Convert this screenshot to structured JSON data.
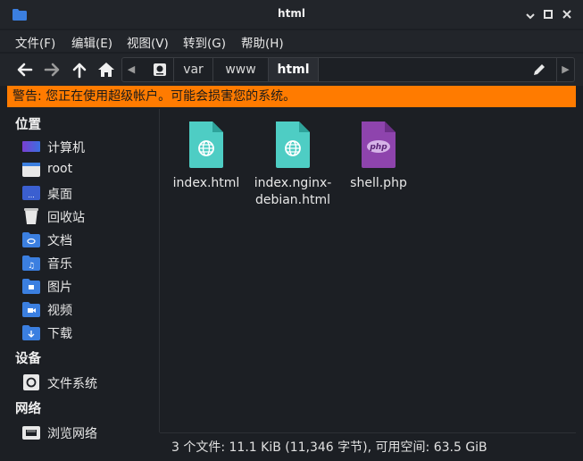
{
  "window": {
    "title": "html"
  },
  "menu": [
    "文件(F)",
    "编辑(E)",
    "视图(V)",
    "转到(G)",
    "帮助(H)"
  ],
  "path": {
    "segments": [
      "var",
      "www",
      "html"
    ],
    "active": "html"
  },
  "warning": "警告: 您正在使用超级帐户。可能会损害您的系统。",
  "sidebar": {
    "places_title": "位置",
    "places": [
      {
        "label": "计算机",
        "icon": "computer-icon"
      },
      {
        "label": "root",
        "icon": "home-folder-icon"
      },
      {
        "label": "桌面",
        "icon": "desktop-icon"
      },
      {
        "label": "回收站",
        "icon": "trash-icon"
      },
      {
        "label": "文档",
        "icon": "documents-folder-icon"
      },
      {
        "label": "音乐",
        "icon": "music-folder-icon"
      },
      {
        "label": "图片",
        "icon": "pictures-folder-icon"
      },
      {
        "label": "视频",
        "icon": "videos-folder-icon"
      },
      {
        "label": "下载",
        "icon": "downloads-folder-icon"
      }
    ],
    "devices_title": "设备",
    "devices": [
      {
        "label": "文件系统",
        "icon": "drive-icon"
      }
    ],
    "network_title": "网络",
    "network": [
      {
        "label": "浏览网络",
        "icon": "network-icon"
      }
    ]
  },
  "files": [
    {
      "name": "index.html",
      "icon": "html-file-icon"
    },
    {
      "name": "index.nginx-debian.html",
      "name_line1": "index.nginx-",
      "name_line2": "debian.html",
      "icon": "html-file-icon"
    },
    {
      "name": "shell.php",
      "icon": "php-file-icon",
      "badge": "php"
    }
  ],
  "status": "3 个文件: 11.1 KiB (11,346 字节), 可用空间: 63.5 GiB",
  "colors": {
    "warning": "#ff7b00",
    "html_icon": "#4ecdc4",
    "php_icon": "#8e44ad",
    "folder_blue": "#3b7fe0"
  }
}
